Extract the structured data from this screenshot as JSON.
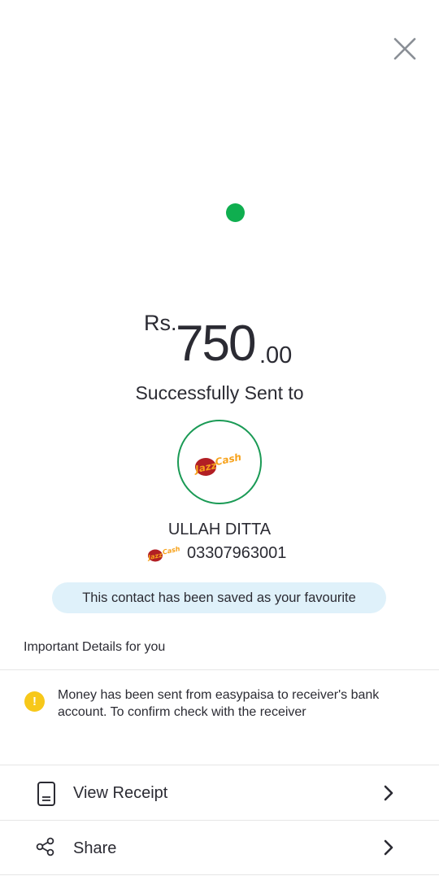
{
  "header": {
    "close_icon": "close-icon"
  },
  "status": {
    "icon": "success-dot",
    "color": "#0fae4f"
  },
  "amount": {
    "currency": "Rs.",
    "whole": "750",
    "decimal": ".00"
  },
  "message": "Successfully Sent to",
  "recipient": {
    "avatar_logo_text": "JazzCash",
    "name": "ULLAH DITTA",
    "number": "03307963001"
  },
  "favourite_banner": "This contact has been saved as your favourite",
  "details": {
    "heading": "Important Details for you",
    "note": "Money has been sent from easypaisa to receiver's bank account. To confirm check with the receiver",
    "warn_glyph": "!"
  },
  "actions": [
    {
      "label": "View Receipt",
      "icon": "receipt-icon"
    },
    {
      "label": "Share",
      "icon": "share-icon"
    }
  ],
  "colors": {
    "accent_green": "#1a9a55",
    "banner_bg": "#dff1fa",
    "warning": "#f7c81a"
  }
}
